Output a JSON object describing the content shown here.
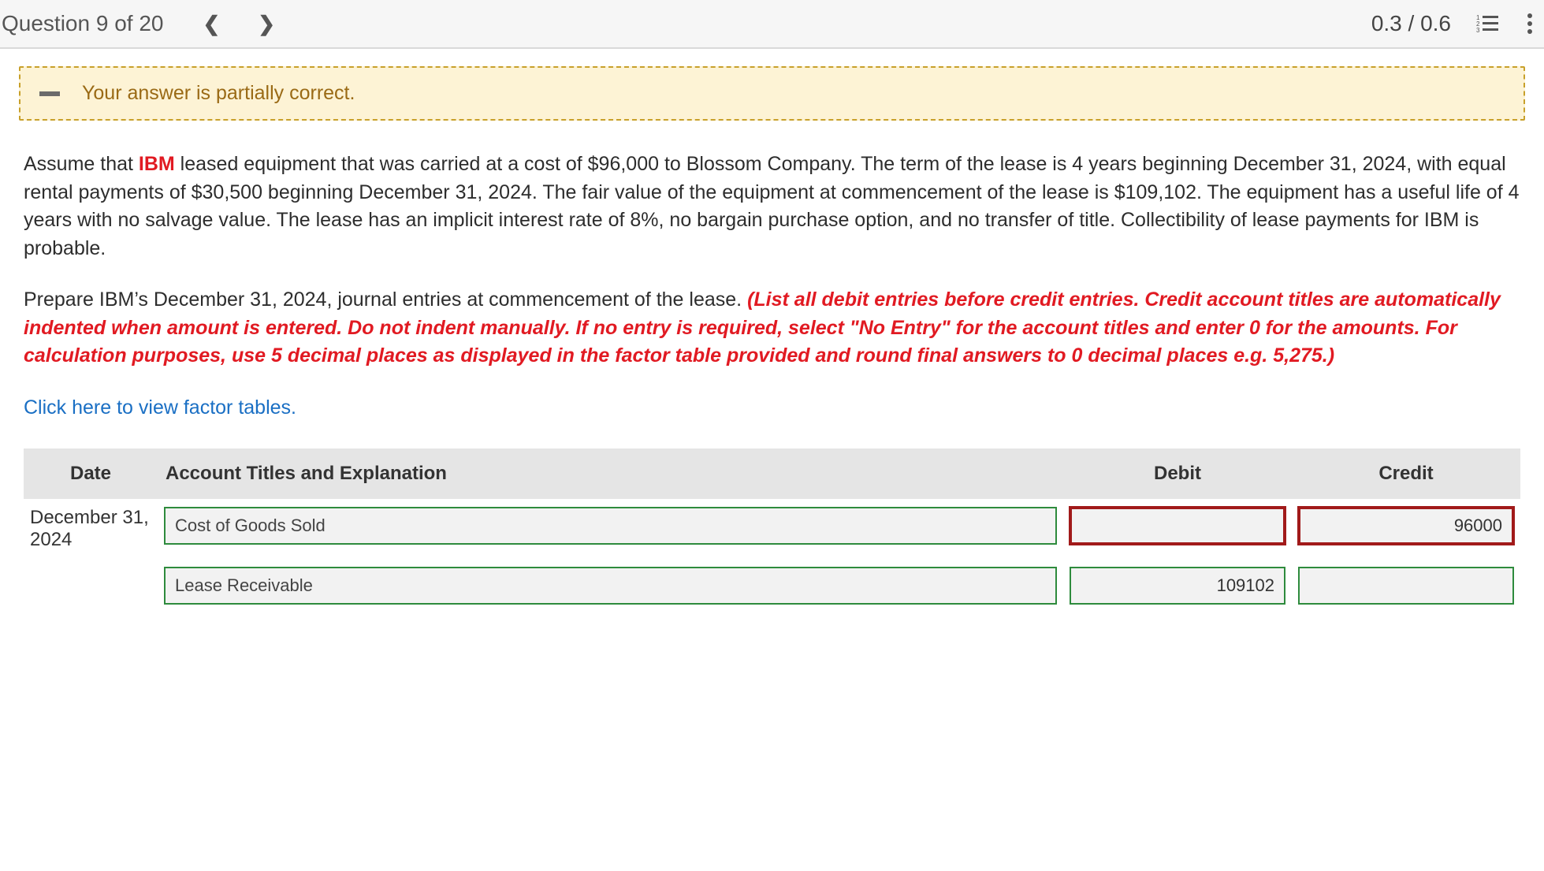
{
  "header": {
    "question_label": "Question 9 of 20",
    "score": "0.3 / 0.6"
  },
  "alert": {
    "text": "Your answer is partially correct."
  },
  "question": {
    "p1_a": "Assume that ",
    "p1_bold": "IBM",
    "p1_b": " leased equipment that was carried at a cost of $96,000 to Blossom Company. The term of the lease is 4 years beginning December 31, 2024, with equal rental payments of $30,500 beginning December 31, 2024. The fair value of the equipment at commencement of the lease is $109,102. The equipment has a useful life of 4 years with no salvage value. The lease has an implicit interest rate of 8%, no bargain purchase option, and no transfer of title. Collectibility of lease payments for IBM is probable.",
    "p2_a": "Prepare IBM’s December 31, 2024, journal entries at commencement of the lease. ",
    "p2_red": "(List all debit entries before credit entries. Credit account titles are automatically indented when amount is entered. Do not indent manually. If no entry is required, select \"No Entry\" for the account titles and enter 0 for the amounts. For calculation purposes, use 5 decimal places as displayed in the factor table provided and round final answers to 0 decimal places e.g. 5,275.)",
    "link_text": "Click here to view factor tables."
  },
  "table": {
    "headers": {
      "date": "Date",
      "acct": "Account Titles and Explanation",
      "debit": "Debit",
      "credit": "Credit"
    },
    "rows": [
      {
        "date": "December 31, 2024",
        "acct": "Cost of Goods Sold",
        "debit": "",
        "credit": "96000",
        "acct_ok": true,
        "debit_ok": false,
        "credit_ok": false
      },
      {
        "date": "",
        "acct": "Lease Receivable",
        "debit": "109102",
        "credit": "",
        "acct_ok": true,
        "debit_ok": true,
        "credit_ok": true
      }
    ]
  }
}
